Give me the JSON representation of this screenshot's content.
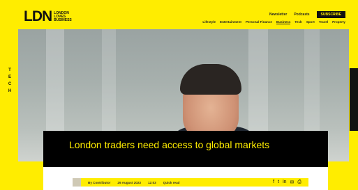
{
  "header": {
    "logo_mark": "LDN",
    "logo_sub": "LONDON LOVES BUSINESS",
    "top_links": [
      "Newsletter",
      "Podcasts"
    ],
    "subscribe_label": "SUBSCRIBE",
    "nav": [
      "Lifestyle",
      "Entertainment",
      "Personal Finance",
      "Business",
      "Tech",
      "Sport",
      "Travel",
      "Property"
    ]
  },
  "side_tabs": {
    "left": [
      "T",
      "E",
      "C",
      "H"
    ]
  },
  "article": {
    "title": "London traders need access to global markets",
    "meta": [
      "By Contributor",
      "29 August 2023",
      "12:03",
      "Quick read"
    ]
  },
  "share": {
    "icons": [
      "facebook-icon",
      "twitter-icon",
      "linkedin-icon",
      "email-icon",
      "print-icon"
    ]
  },
  "colors": {
    "brand_yellow": "#ffed00",
    "black": "#000000"
  }
}
